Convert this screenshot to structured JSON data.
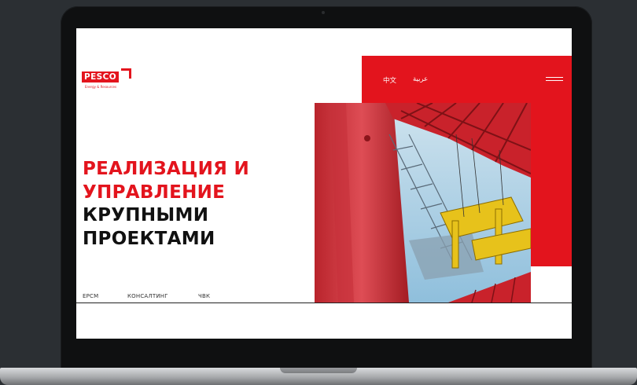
{
  "brand": {
    "logo_text": "PESCO",
    "tagline": "Energy & Resources"
  },
  "header": {
    "languages": [
      "中文",
      "عربية"
    ],
    "menu_icon": "hamburger-menu-icon"
  },
  "hero": {
    "headline_red": [
      "РЕАЛИЗАЦИЯ И",
      "УПРАВЛЕНИЕ"
    ],
    "headline_dark": [
      "КРУПНЫМИ",
      "ПРОЕКТАМИ"
    ],
    "image_subject": "red gantry crane with yellow spreader"
  },
  "services": [
    "EPCM",
    "КОНСАЛТИНГ",
    "ЧВК"
  ],
  "colors": {
    "accent": "#e3141d",
    "text_dark": "#111111",
    "background": "#ffffff",
    "frame": "#0f1011"
  }
}
